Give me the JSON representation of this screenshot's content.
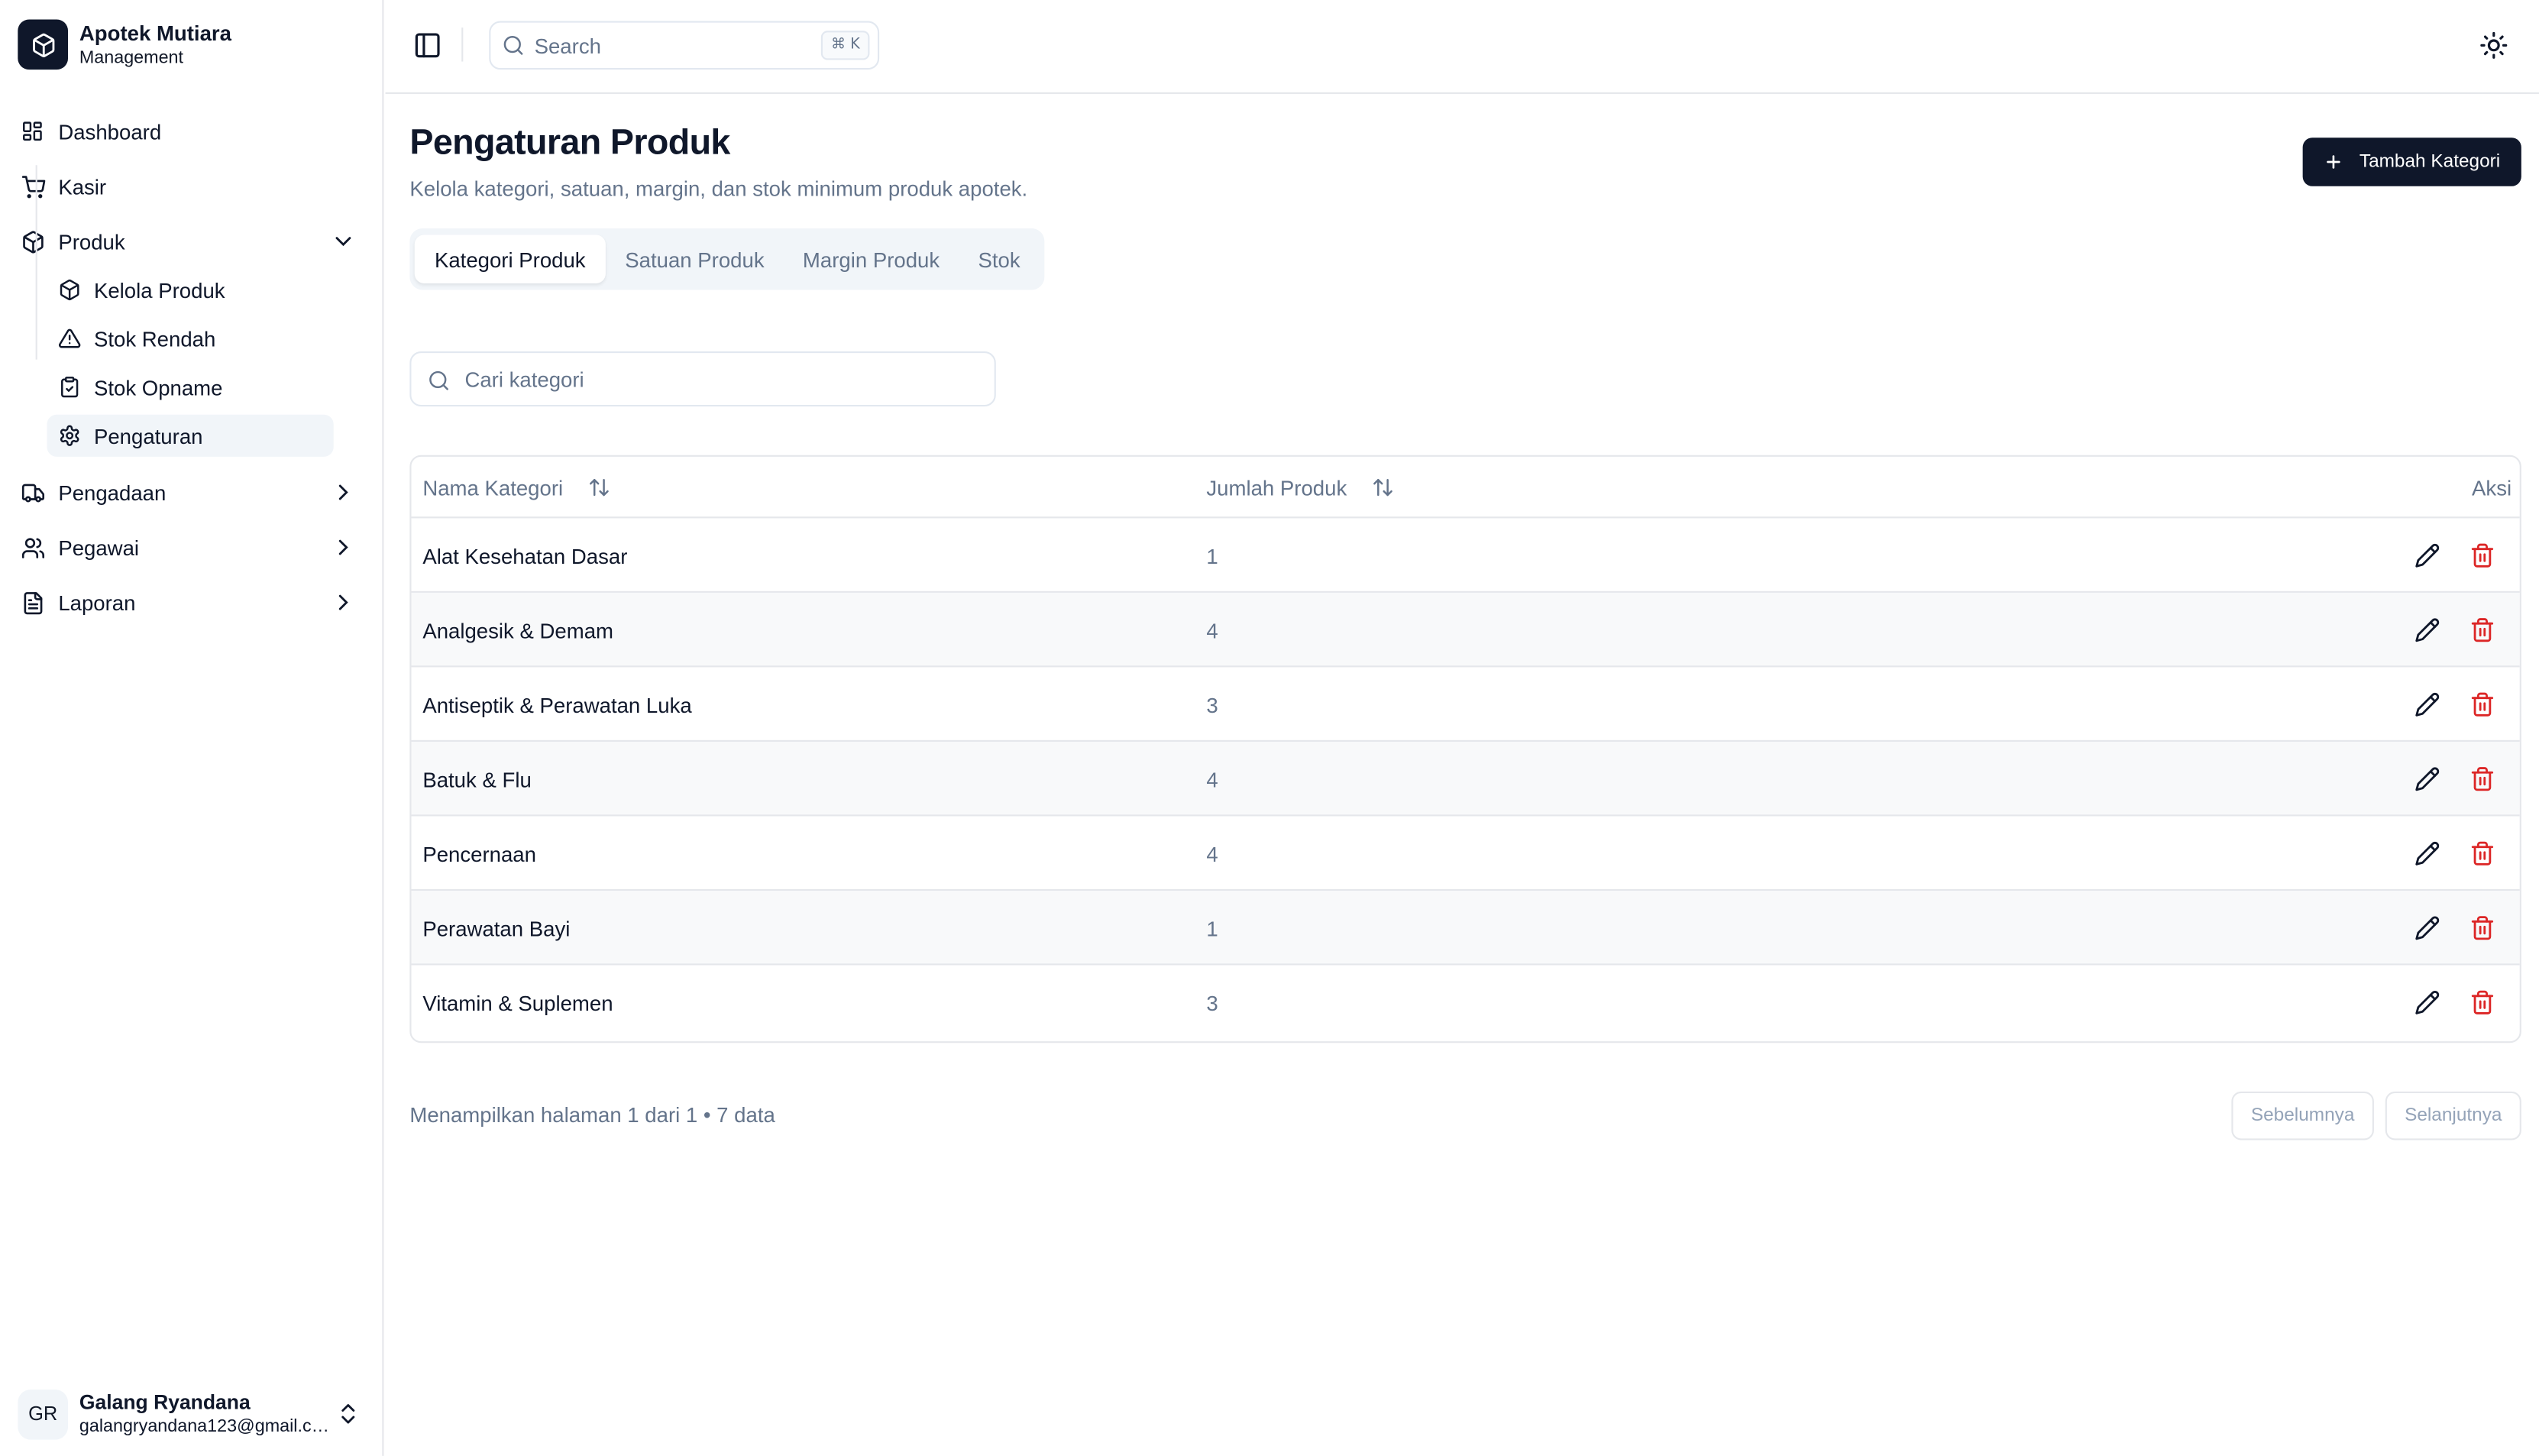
{
  "brand": {
    "name": "Apotek Mutiara",
    "subtitle": "Management",
    "logo_icon": "box-icon"
  },
  "sidebar": {
    "items": [
      {
        "label": "Dashboard",
        "icon": "layout-dashboard-icon"
      },
      {
        "label": "Kasir",
        "icon": "shopping-cart-icon"
      },
      {
        "label": "Produk",
        "icon": "package-icon",
        "expanded": true
      },
      {
        "label": "Pengadaan",
        "icon": "truck-icon"
      },
      {
        "label": "Pegawai",
        "icon": "users-icon"
      },
      {
        "label": "Laporan",
        "icon": "file-text-icon"
      }
    ],
    "produk_sub": [
      {
        "label": "Kelola Produk",
        "icon": "package-icon"
      },
      {
        "label": "Stok Rendah",
        "icon": "alert-triangle-icon"
      },
      {
        "label": "Stok Opname",
        "icon": "clipboard-check-icon"
      },
      {
        "label": "Pengaturan",
        "icon": "settings-icon",
        "active": true
      }
    ]
  },
  "user": {
    "initials": "GR",
    "name": "Galang Ryandana",
    "email": "galangryandana123@gmail.com"
  },
  "header": {
    "search_label": "Search",
    "search_shortcut": "⌘ K"
  },
  "page": {
    "title": "Pengaturan Produk",
    "subtitle": "Kelola kategori, satuan, margin, dan stok minimum produk apotek.",
    "add_button": "Tambah Kategori"
  },
  "tabs": [
    {
      "label": "Kategori Produk",
      "active": true
    },
    {
      "label": "Satuan Produk",
      "active": false
    },
    {
      "label": "Margin Produk",
      "active": false
    },
    {
      "label": "Stok",
      "active": false
    }
  ],
  "filter": {
    "placeholder": "Cari kategori"
  },
  "table": {
    "columns": {
      "name": "Nama Kategori",
      "count": "Jumlah Produk",
      "actions": "Aksi"
    },
    "rows": [
      {
        "name": "Alat Kesehatan Dasar",
        "count": "1"
      },
      {
        "name": "Analgesik & Demam",
        "count": "4"
      },
      {
        "name": "Antiseptik & Perawatan Luka",
        "count": "3"
      },
      {
        "name": "Batuk & Flu",
        "count": "4"
      },
      {
        "name": "Pencernaan",
        "count": "4"
      },
      {
        "name": "Perawatan Bayi",
        "count": "1"
      },
      {
        "name": "Vitamin & Suplemen",
        "count": "3"
      }
    ]
  },
  "pagination": {
    "info": "Menampilkan halaman 1 dari 1 • 7 data",
    "prev": "Sebelumnya",
    "next": "Selanjutnya"
  },
  "colors": {
    "primary": "#0f172a",
    "muted": "#64748b",
    "danger": "#dc2626",
    "border": "#e5e7eb"
  }
}
